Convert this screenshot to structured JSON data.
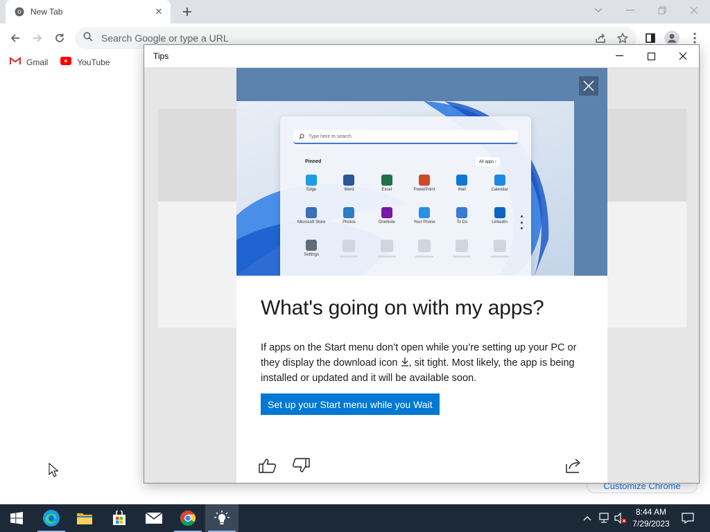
{
  "browser": {
    "tab": {
      "title": "New Tab"
    },
    "omnibox": {
      "placeholder": "Search Google or type a URL"
    },
    "bookmarks": [
      {
        "label": "Gmail",
        "icon": "gmail-icon"
      },
      {
        "label": "YouTube",
        "icon": "youtube-icon"
      }
    ],
    "customize_label": "Customize Chrome"
  },
  "tips": {
    "window_title": "Tips",
    "heading": "What's going on with my apps?",
    "body_part1": "If apps on the Start menu don’t open while you’re setting up your PC or they display the download icon",
    "body_part2": ", sit tight. Most likely, the app is being installed or updated and it will be available soon.",
    "action_label": "Set up your Start menu while you Wait",
    "hero": {
      "search_placeholder": "Type here to search",
      "pinned_label": "Pinned",
      "all_apps_label": "All apps",
      "apps": [
        {
          "name": "Edge",
          "color": "#1b9de2"
        },
        {
          "name": "Word",
          "color": "#2b5797"
        },
        {
          "name": "Excel",
          "color": "#1f7244"
        },
        {
          "name": "PowerPoint",
          "color": "#d24726"
        },
        {
          "name": "Mail",
          "color": "#0f78d4"
        },
        {
          "name": "Calendar",
          "color": "#1e88e5"
        },
        {
          "name": "Microsoft Store",
          "color": "#3b6fb6"
        },
        {
          "name": "Photos",
          "color": "#2d7dc9"
        },
        {
          "name": "OneNote",
          "color": "#7719aa"
        },
        {
          "name": "Your Phone",
          "color": "#2a8fe6"
        },
        {
          "name": "To Do",
          "color": "#3a7bd5"
        },
        {
          "name": "LinkedIn",
          "color": "#0a66c2"
        },
        {
          "name": "Settings",
          "color": "#5f6b78"
        }
      ]
    }
  },
  "taskbar": {
    "apps": [
      "start-icon",
      "edge-icon",
      "file-explorer-icon",
      "store-icon",
      "mail-icon",
      "chrome-icon",
      "tips-icon"
    ],
    "time": "8:44 AM",
    "date": "7/29/2023"
  }
}
